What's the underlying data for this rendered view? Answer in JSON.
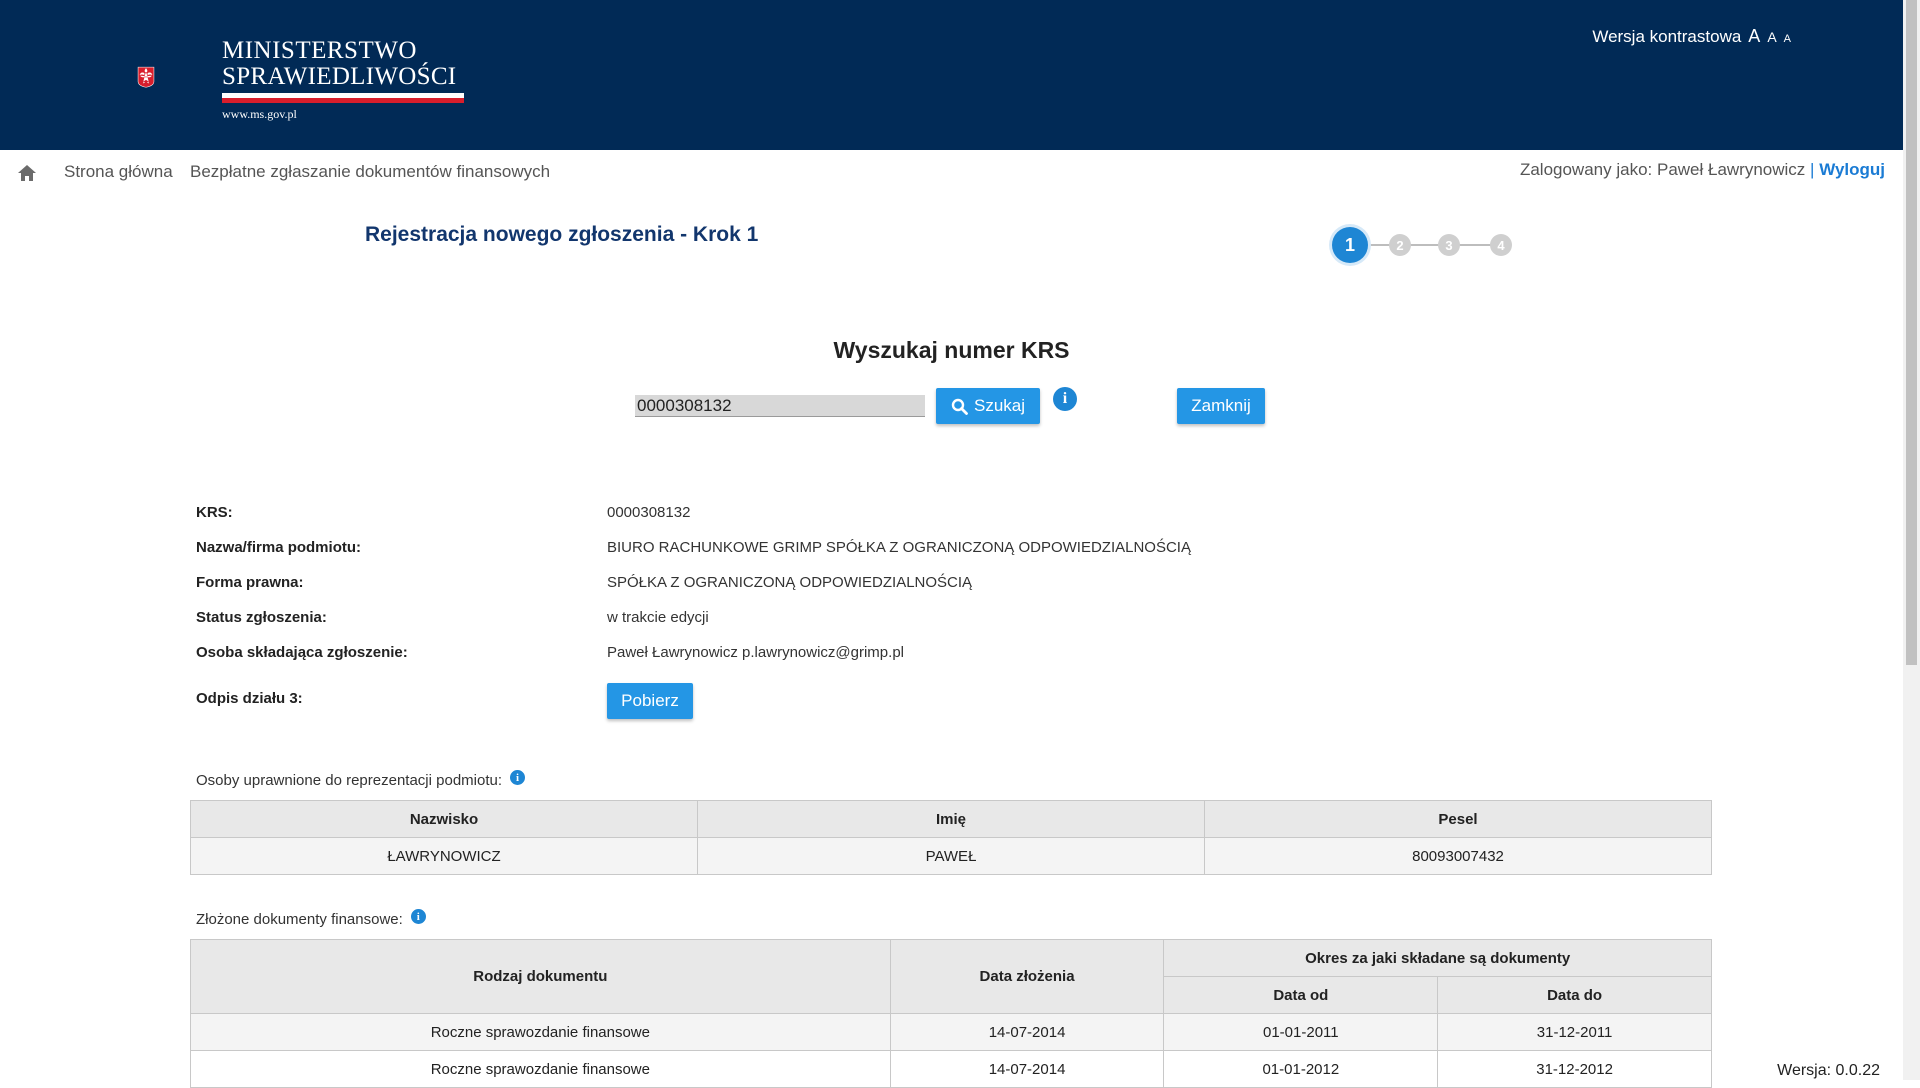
{
  "header": {
    "logo_line1": "MINISTERSTWO",
    "logo_line2": "SPRAWIEDLIWOŚCI",
    "logo_url": "www.ms.gov.pl",
    "contrast_label": "Wersja kontrastowa",
    "font_size_large": "A",
    "font_size_medium": "A",
    "font_size_small": "A",
    "background_color": "#012a56"
  },
  "nav": {
    "home_icon": "home-icon",
    "breadcrumb_home": "Strona główna",
    "breadcrumb_current": "Bezpłatne zgłaszanie dokumentów finansowych",
    "logged_in_label": "Zalogowany jako: Paweł Ławrynowicz",
    "separator": "|",
    "logout_label": "Wyloguj"
  },
  "step": {
    "title": "Rejestracja nowego zgłoszenia - Krok 1",
    "steps": [
      "1",
      "2",
      "3",
      "4"
    ],
    "active_step": 1
  },
  "search": {
    "title": "Wyszukaj numer KRS",
    "input_value": "0000308132",
    "search_label": "Szukaj",
    "info_icon": "i",
    "close_label": "Zamknij"
  },
  "details": {
    "krs_label": "KRS:",
    "krs_value": "0000308132",
    "name_label": "Nazwa/firma podmiotu:",
    "name_value": "BIURO RACHUNKOWE GRIMP SPÓŁKA Z OGRANICZONĄ ODPOWIEDZIALNOŚCIĄ",
    "legal_form_label": "Forma prawna:",
    "legal_form_value": "SPÓŁKA Z OGRANICZONĄ ODPOWIEDZIALNOŚCIĄ",
    "status_label": "Status zgłoszenia:",
    "status_value": "w trakcie edycji",
    "submitter_label": "Osoba składająca zgłoszenie:",
    "submitter_value": "Paweł Ławrynowicz p.lawrynowicz@grimp.pl",
    "extract_label": "Odpis działu 3:",
    "extract_button": "Pobierz"
  },
  "representatives": {
    "label": "Osoby uprawnione do reprezentacji podmiotu:",
    "info_icon": "i",
    "headers": [
      "Nazwisko",
      "Imię",
      "Pesel"
    ],
    "rows": [
      [
        "ŁAWRYNOWICZ",
        "PAWEŁ",
        "80093007432"
      ]
    ]
  },
  "documents": {
    "label": "Złożone dokumenty finansowe:",
    "info_icon": "i",
    "header_type": "Rodzaj dokumentu",
    "header_date": "Data złożenia",
    "header_period": "Okres za jaki składane są dokumenty",
    "header_from": "Data od",
    "header_to": "Data do",
    "rows": [
      [
        "Roczne sprawozdanie finansowe",
        "14-07-2014",
        "01-01-2011",
        "31-12-2011"
      ],
      [
        "Roczne sprawozdanie finansowe",
        "14-07-2014",
        "01-01-2012",
        "31-12-2012"
      ]
    ]
  },
  "footer": {
    "version": "Wersja: 0.0.22"
  },
  "colors": {
    "accent": "#2496e5",
    "title_blue": "#12366d",
    "link_blue": "#1a7bd4"
  }
}
